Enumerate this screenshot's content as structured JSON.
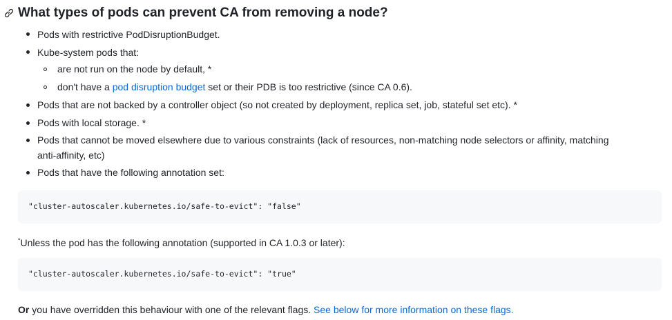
{
  "heading": {
    "text": "What types of pods can prevent CA from removing a node?",
    "anchor_icon": "link-icon"
  },
  "items": [
    {
      "text": "Pods with restrictive PodDisruptionBudget."
    },
    {
      "text": "Kube-system pods that:"
    },
    {
      "text": "are not run on the node by default, *"
    },
    {
      "before": "don't have a ",
      "link": "pod disruption budget",
      "after": " set or their PDB is too restrictive (since CA 0.6)."
    },
    {
      "text": "Pods that are not backed by a controller object (so not created by deployment, replica set, job, stateful set etc). *"
    },
    {
      "text": "Pods with local storage. *"
    },
    {
      "line1": "Pods that cannot be moved elsewhere due to various constraints (lack of resources, non-matching node selectors or affinity, matching",
      "line2": "anti-affinity, etc)"
    },
    {
      "text": "Pods that have the following annotation set:"
    }
  ],
  "code1": "\"cluster-autoscaler.kubernetes.io/safe-to-evict\": \"false\"",
  "note": {
    "marker": "*",
    "text": "Unless the pod has the following annotation (supported in CA 1.0.3 or later):"
  },
  "code2": "\"cluster-autoscaler.kubernetes.io/safe-to-evict\": \"true\"",
  "footer": {
    "bold": "Or",
    "text": " you have overridden this behaviour with one of the relevant flags. ",
    "link": "See below for more information on these flags."
  },
  "colors": {
    "text": "#1f2328",
    "link": "#0969da",
    "code_bg": "#f6f8fa"
  }
}
